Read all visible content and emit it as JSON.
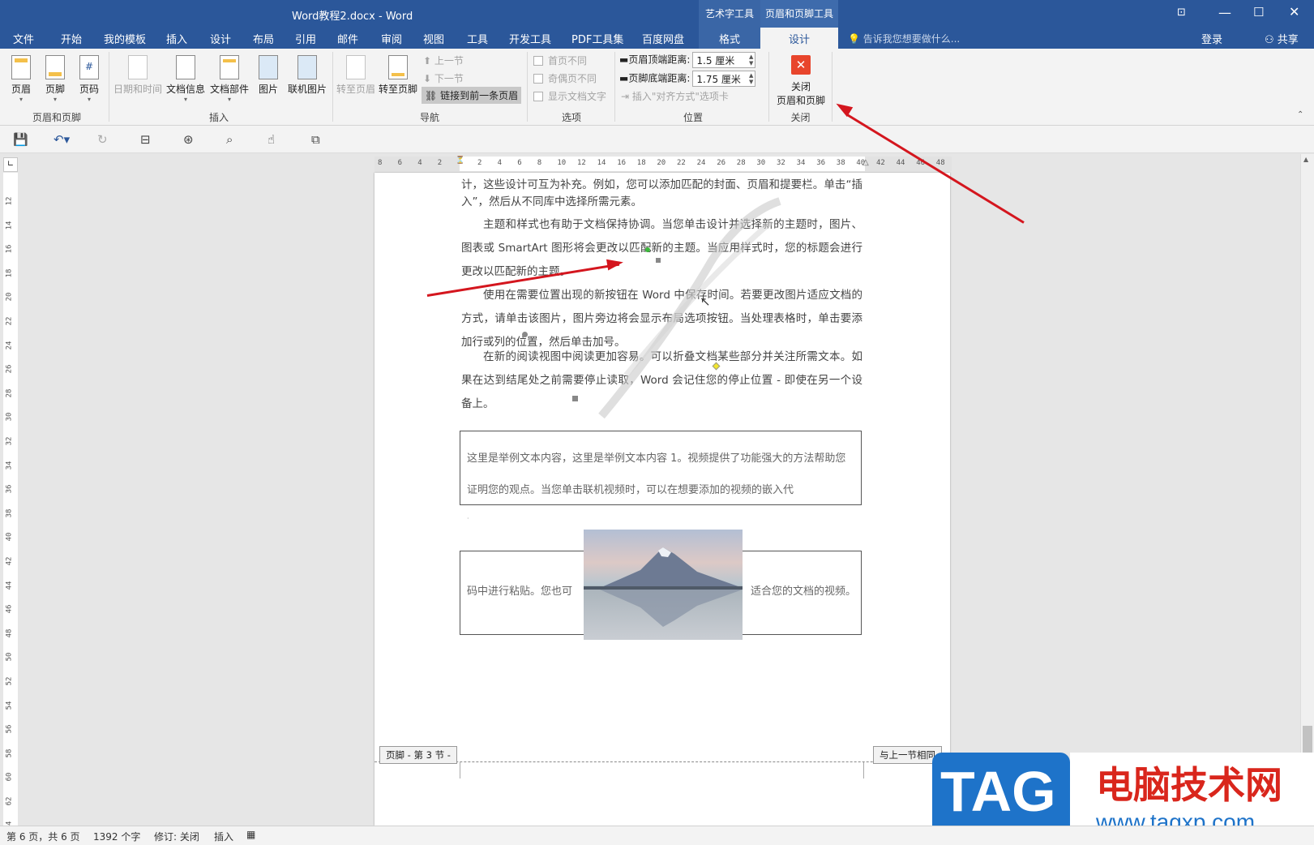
{
  "window": {
    "title": "Word教程2.docx - Word",
    "ctx_tool_1": "艺术字工具",
    "ctx_tool_2": "页眉和页脚工具"
  },
  "menu": {
    "items": [
      "文件",
      "开始",
      "我的模板",
      "插入",
      "设计",
      "布局",
      "引用",
      "邮件",
      "审阅",
      "视图",
      "工具",
      "开发工具",
      "PDF工具集",
      "百度网盘"
    ],
    "ctx_tab_1": "格式",
    "ctx_tab_2": "设计",
    "tellme": "告诉我您想要做什么...",
    "login": "登录",
    "share": "共享"
  },
  "ribbon": {
    "hf": {
      "header": "页眉",
      "footer": "页脚",
      "pagenum": "页码",
      "label": "页眉和页脚"
    },
    "insert": {
      "datetime": "日期和时间",
      "docinfo": "文档信息",
      "parts": "文档部件",
      "picture": "图片",
      "online": "联机图片",
      "label": "插入"
    },
    "nav": {
      "goto_header": "转至页眉",
      "goto_footer": "转至页脚",
      "prev": "上一节",
      "next": "下一节",
      "link": "链接到前一条页眉",
      "label": "导航"
    },
    "options": {
      "first": "首页不同",
      "oddeven": "奇偶页不同",
      "showtext": "显示文档文字",
      "label": "选项"
    },
    "position": {
      "top_label": "页眉顶端距离:",
      "top_value": "1.5 厘米",
      "bottom_label": "页脚底端距离:",
      "bottom_value": "1.75 厘米",
      "align": "插入\"对齐方式\"选项卡",
      "label": "位置"
    },
    "close": {
      "line1": "关闭",
      "line2": "页眉和页脚",
      "label": "关闭"
    }
  },
  "ruler": {
    "h": [
      "8",
      "6",
      "4",
      "2",
      "",
      "2",
      "4",
      "6",
      "8",
      "10",
      "12",
      "14",
      "16",
      "18",
      "20",
      "22",
      "24",
      "26",
      "28",
      "30",
      "32",
      "34",
      "36",
      "38",
      "40",
      "42",
      "44",
      "46",
      "48"
    ],
    "v": [
      "12",
      "14",
      "16",
      "18",
      "20",
      "22",
      "24",
      "26",
      "28",
      "30",
      "32",
      "34",
      "36",
      "38",
      "40",
      "42",
      "44",
      "46",
      "48",
      "50",
      "52",
      "54",
      "56",
      "58",
      "60",
      "62",
      "64"
    ]
  },
  "doc": {
    "p1": "计，这些设计可互为补充。例如，您可以添加匹配的封面、页眉和提要栏。单击“插入”，然后从不同库中选择所需元素。",
    "p2": "主题和样式也有助于文档保持协调。当您单击设计并选择新的主题时，图片、图表或 SmartArt 图形将会更改以匹配新的主题。当应用样式时，您的标题会进行更改以匹配新的主题。",
    "p3": "使用在需要位置出现的新按钮在 Word 中保存时间。若要更改图片适应文档的方式，请单击该图片，图片旁边将会显示布局选项按钮。当处理表格时，单击要添加行或列的位置，然后单击加号。",
    "p4": "在新的阅读视图中阅读更加容易。可以折叠文档某些部分并关注所需文本。如果在达到结尾处之前需要停止读取，Word 会记住您的停止位置 - 即使在另一个设备上。",
    "box1": "这里是举例文本内容，这里是举例文本内容 1。视频提供了功能强大的方法帮助您证明您的观点。当您单击联机视频时，可以在想要添加的视频的嵌入代",
    "box2_left": "码中进行粘贴。您也可",
    "box2_right": "适合您的文档的视频。",
    "footer_tag": "页脚 - 第 3 节 -",
    "same_prev": "与上一节相同"
  },
  "status": {
    "page": "第 6 页，共 6 页",
    "words": "1392 个字",
    "track": "修订: 关闭",
    "mode": "插入"
  },
  "watermark": {
    "tag": "TAG",
    "cn": "电脑技术网",
    "url": "www.tagxp.com"
  },
  "colors": {
    "accent": "#2b579a",
    "arrow": "#d4161e",
    "close": "#e8452c"
  }
}
